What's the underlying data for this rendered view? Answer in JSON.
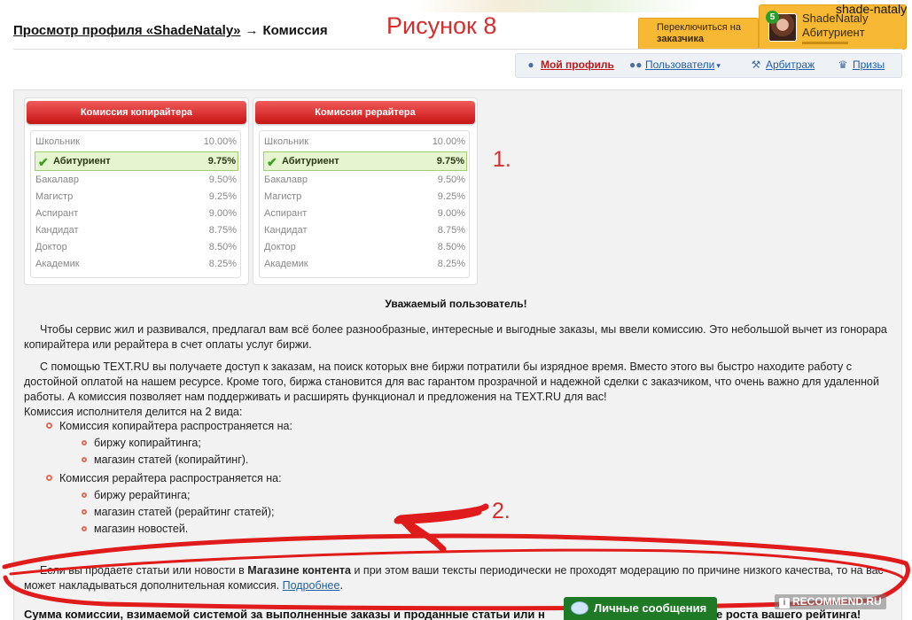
{
  "header": {
    "breadcrumb_profile": "Просмотр профиля «ShadeNataly»",
    "arrow": "→",
    "page_title": "Комиссия",
    "annotation_title": "Рисунок 8",
    "switch_line1": "Переключиться на",
    "switch_line2": "заказчика",
    "user_name": "ShadeNataly",
    "user_rank": "Абитуриент",
    "avatar_badge": "5",
    "user_login_label": "shade-nataly"
  },
  "nav": {
    "items": [
      {
        "label": "Мой профиль",
        "icon": "user-icon",
        "active": true
      },
      {
        "label": "Пользователи",
        "icon": "users-icon",
        "caret": "▾"
      },
      {
        "label": "Арбитраж",
        "icon": "gavel-icon"
      },
      {
        "label": "Призы",
        "icon": "trophy-icon"
      }
    ]
  },
  "cards": [
    {
      "title": "Комиссия копирайтера",
      "rows": [
        {
          "name": "Школьник",
          "rate": "10.00%"
        },
        {
          "name": "Абитуриент",
          "rate": "9.75%",
          "active": true
        },
        {
          "name": "Бакалавр",
          "rate": "9.50%"
        },
        {
          "name": "Магистр",
          "rate": "9.25%"
        },
        {
          "name": "Аспирант",
          "rate": "9.00%"
        },
        {
          "name": "Кандидат",
          "rate": "8.75%"
        },
        {
          "name": "Доктор",
          "rate": "8.50%"
        },
        {
          "name": "Академик",
          "rate": "8.25%"
        }
      ]
    },
    {
      "title": "Комиссия рерайтера",
      "rows": [
        {
          "name": "Школьник",
          "rate": "10.00%"
        },
        {
          "name": "Абитуриент",
          "rate": "9.75%",
          "active": true
        },
        {
          "name": "Бакалавр",
          "rate": "9.50%"
        },
        {
          "name": "Магистр",
          "rate": "9.25%"
        },
        {
          "name": "Аспирант",
          "rate": "9.00%"
        },
        {
          "name": "Кандидат",
          "rate": "8.75%"
        },
        {
          "name": "Доктор",
          "rate": "8.50%"
        },
        {
          "name": "Академик",
          "rate": "8.25%"
        }
      ]
    }
  ],
  "annotations": {
    "one": "1.",
    "two": "2."
  },
  "text": {
    "greeting": "Уважаемый пользователь!",
    "p1": "Чтобы сервис жил и развивался, предлагал вам всё более разнообразные, интересные и выгодные заказы, мы ввели комиссию. Это небольшой вычет из гонорара копирайтера или рерайтера в счет оплаты услуг биржи.",
    "p2": "С помощью TEXT.RU вы получаете доступ к заказам, на поиск которых вне биржи потратили бы изрядное время. Вместо этого вы быстро находите работу с достойной оплатой на нашем ресурсе. Кроме того, биржа становится для вас гарантом прозрачной и надежной сделки с заказчиком, что очень важно для удаленной работы. А комиссия позволяет нам поддерживать и расширять функционал и предложения на TEXT.RU для вас!",
    "p3": "Комиссия исполнителя делится на 2 вида:",
    "list1_title": "Комиссия копирайтера распространяется на:",
    "list1_a": "биржу копирайтинга;",
    "list1_b": "магазин статей (копирайтинг).",
    "list2_title": "Комиссия рерайтера распространяется на:",
    "list2_a": "биржу рерайтинга;",
    "list2_b": "магазин статей (рерайтинг статей);",
    "list2_c": "магазин новостей.",
    "p4_start": "Если вы продаете статьи или новости в",
    "p4_bold": "Магазине контента",
    "p4_end": "и при этом ваши тексты периодически не проходят модерацию по причине низкого качества, то на вас может накладываться дополнительная комиссия.",
    "p4_link": "Подробнее",
    "p4_dot": ".",
    "bottom": "Сумма комиссии, взимаемой системой за выполненные заказы и проданные статьи или н",
    "bottom_tail": "ере роста вашего рейтинга!"
  },
  "messages_button": "Личные сообщения",
  "watermark": "RECOMMEND.RU",
  "colors": {
    "accent_red": "#c81414",
    "link": "#2160a8",
    "annotation": "#d32f2f",
    "orange": "#f7b933",
    "green": "#1f7a26"
  }
}
